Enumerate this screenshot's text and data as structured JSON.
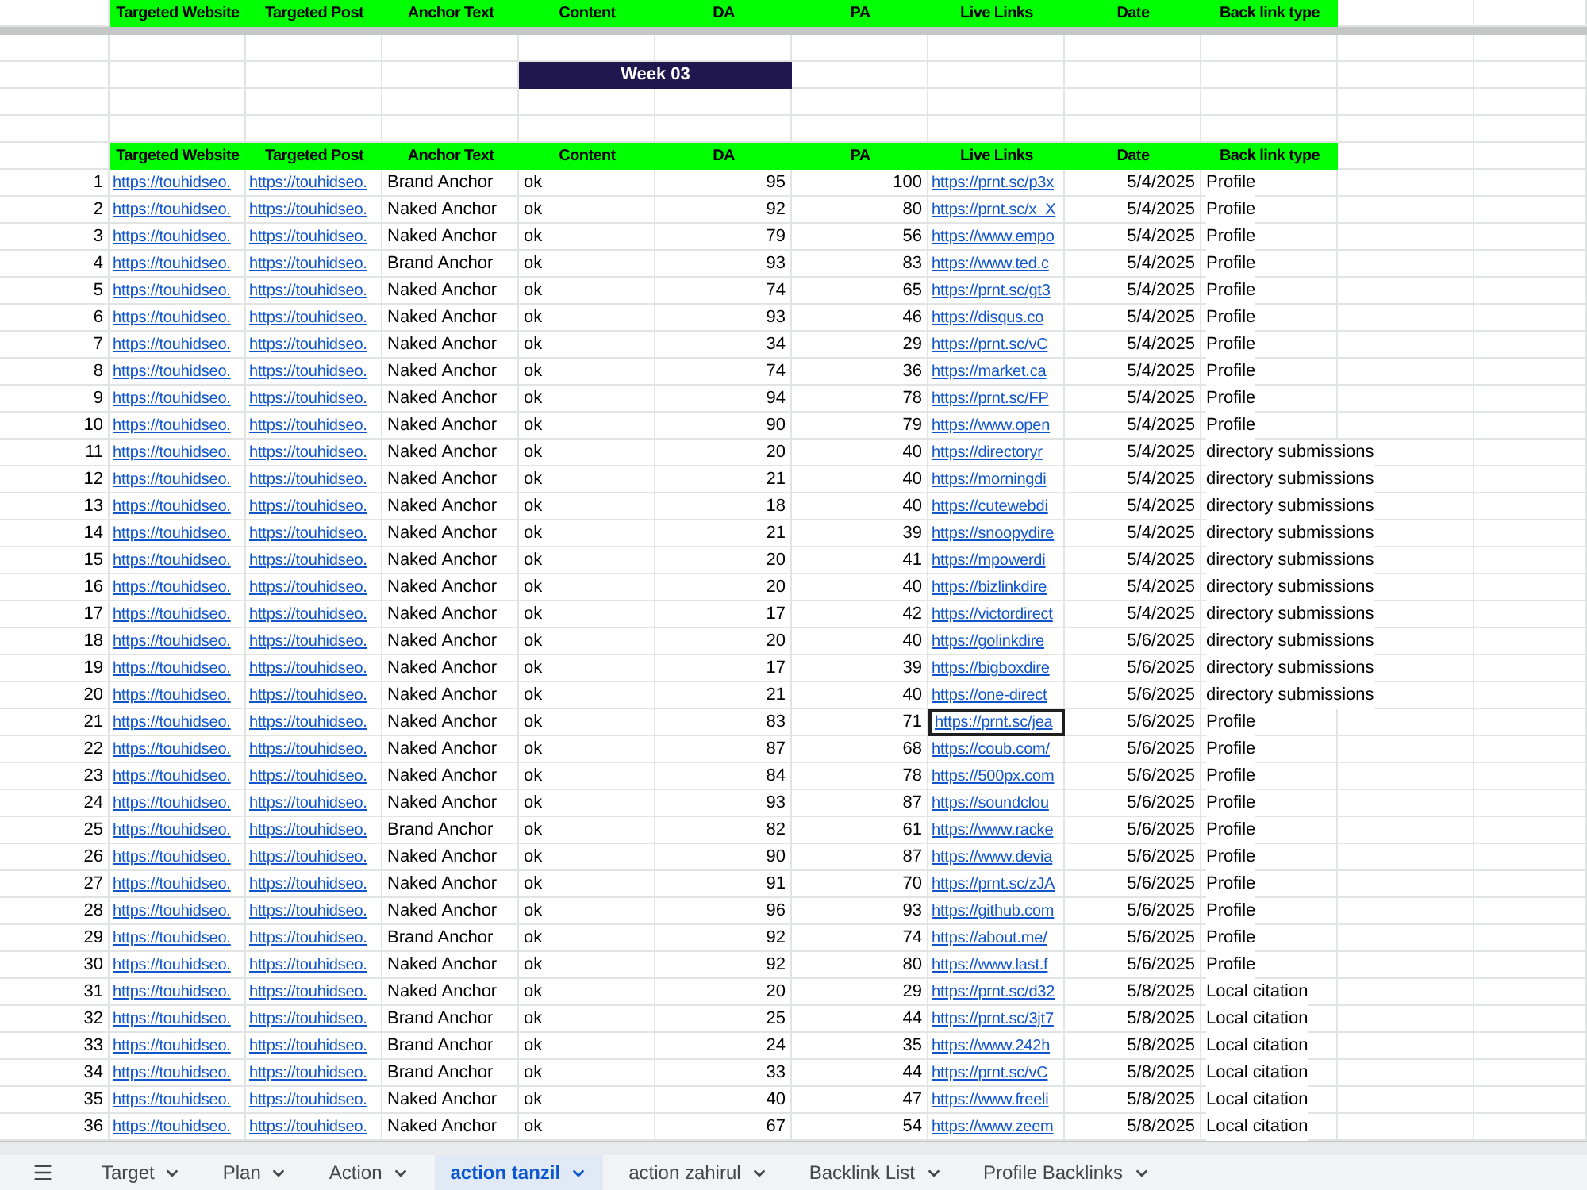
{
  "frozen_header": [
    "Targeted Website",
    "Targeted Post",
    "Anchor Text",
    "Content",
    "DA",
    "PA",
    "Live Links",
    "Date",
    "Back link type"
  ],
  "week_label": "Week 03",
  "table": {
    "columns": [
      "Targeted Website",
      "Targeted Post",
      "Anchor Text",
      "Content",
      "DA",
      "PA",
      "Live Links",
      "Date",
      "Back link type"
    ],
    "rows": [
      {
        "n": "1",
        "website": "https://touhidseo.",
        "post": "https://touhidseo.",
        "anchor": "Brand Anchor",
        "content": "ok",
        "da": "95",
        "pa": "100",
        "link": "https://prnt.sc/p3x",
        "date": "5/4/2025",
        "type": "Profile",
        "selected": false
      },
      {
        "n": "2",
        "website": "https://touhidseo.",
        "post": "https://touhidseo.",
        "anchor": "Naked Anchor",
        "content": "ok",
        "da": "92",
        "pa": "80",
        "link": "https://prnt.sc/x_X",
        "date": "5/4/2025",
        "type": "Profile",
        "selected": false
      },
      {
        "n": "3",
        "website": "https://touhidseo.",
        "post": "https://touhidseo.",
        "anchor": "Naked Anchor",
        "content": "ok",
        "da": "79",
        "pa": "56",
        "link": "https://www.empo",
        "date": "5/4/2025",
        "type": "Profile",
        "selected": false
      },
      {
        "n": "4",
        "website": "https://touhidseo.",
        "post": "https://touhidseo.",
        "anchor": "Brand Anchor",
        "content": "ok",
        "da": "93",
        "pa": "83",
        "link": "https://www.ted.c",
        "date": "5/4/2025",
        "type": "Profile",
        "selected": false
      },
      {
        "n": "5",
        "website": "https://touhidseo.",
        "post": "https://touhidseo.",
        "anchor": "Naked Anchor",
        "content": "ok",
        "da": "74",
        "pa": "65",
        "link": "https://prnt.sc/gt3",
        "date": "5/4/2025",
        "type": "Profile",
        "selected": false
      },
      {
        "n": "6",
        "website": "https://touhidseo.",
        "post": "https://touhidseo.",
        "anchor": "Naked Anchor",
        "content": "ok",
        "da": "93",
        "pa": "46",
        "link": "https://disqus.co",
        "date": "5/4/2025",
        "type": "Profile",
        "selected": false
      },
      {
        "n": "7",
        "website": "https://touhidseo.",
        "post": "https://touhidseo.",
        "anchor": "Naked Anchor",
        "content": "ok",
        "da": "34",
        "pa": "29",
        "link": "https://prnt.sc/vC",
        "date": "5/4/2025",
        "type": "Profile",
        "selected": false
      },
      {
        "n": "8",
        "website": "https://touhidseo.",
        "post": "https://touhidseo.",
        "anchor": "Naked Anchor",
        "content": "ok",
        "da": "74",
        "pa": "36",
        "link": "https://market.ca",
        "date": "5/4/2025",
        "type": "Profile",
        "selected": false
      },
      {
        "n": "9",
        "website": "https://touhidseo.",
        "post": "https://touhidseo.",
        "anchor": "Naked Anchor",
        "content": "ok",
        "da": "94",
        "pa": "78",
        "link": "https://prnt.sc/FP",
        "date": "5/4/2025",
        "type": "Profile",
        "selected": false
      },
      {
        "n": "10",
        "website": "https://touhidseo.",
        "post": "https://touhidseo.",
        "anchor": "Naked Anchor",
        "content": "ok",
        "da": "90",
        "pa": "79",
        "link": "https://www.open",
        "date": "5/4/2025",
        "type": "Profile",
        "selected": false
      },
      {
        "n": "11",
        "website": "https://touhidseo.",
        "post": "https://touhidseo.",
        "anchor": "Naked Anchor",
        "content": "ok",
        "da": "20",
        "pa": "40",
        "link": "https://directoryr",
        "date": "5/4/2025",
        "type": "directory submissions",
        "selected": false
      },
      {
        "n": "12",
        "website": "https://touhidseo.",
        "post": "https://touhidseo.",
        "anchor": "Naked Anchor",
        "content": "ok",
        "da": "21",
        "pa": "40",
        "link": "https://morningdi",
        "date": "5/4/2025",
        "type": "directory submissions",
        "selected": false
      },
      {
        "n": "13",
        "website": "https://touhidseo.",
        "post": "https://touhidseo.",
        "anchor": "Naked Anchor",
        "content": "ok",
        "da": "18",
        "pa": "40",
        "link": "https://cutewebdi",
        "date": "5/4/2025",
        "type": "directory submissions",
        "selected": false
      },
      {
        "n": "14",
        "website": "https://touhidseo.",
        "post": "https://touhidseo.",
        "anchor": "Naked Anchor",
        "content": "ok",
        "da": "21",
        "pa": "39",
        "link": "https://snoopydire",
        "date": "5/4/2025",
        "type": "directory submissions",
        "selected": false
      },
      {
        "n": "15",
        "website": "https://touhidseo.",
        "post": "https://touhidseo.",
        "anchor": "Naked Anchor",
        "content": "ok",
        "da": "20",
        "pa": "41",
        "link": "https://mpowerdi",
        "date": "5/4/2025",
        "type": "directory submissions",
        "selected": false
      },
      {
        "n": "16",
        "website": "https://touhidseo.",
        "post": "https://touhidseo.",
        "anchor": "Naked Anchor",
        "content": "ok",
        "da": "20",
        "pa": "40",
        "link": "https://bizlinkdire",
        "date": "5/4/2025",
        "type": "directory submissions",
        "selected": false
      },
      {
        "n": "17",
        "website": "https://touhidseo.",
        "post": "https://touhidseo.",
        "anchor": "Naked Anchor",
        "content": "ok",
        "da": "17",
        "pa": "42",
        "link": "https://victordirect",
        "date": "5/4/2025",
        "type": "directory submissions",
        "selected": false
      },
      {
        "n": "18",
        "website": "https://touhidseo.",
        "post": "https://touhidseo.",
        "anchor": "Naked Anchor",
        "content": "ok",
        "da": "20",
        "pa": "40",
        "link": "https://golinkdire",
        "date": "5/6/2025",
        "type": "directory submissions",
        "selected": false
      },
      {
        "n": "19",
        "website": "https://touhidseo.",
        "post": "https://touhidseo.",
        "anchor": "Naked Anchor",
        "content": "ok",
        "da": "17",
        "pa": "39",
        "link": "https://bigboxdire",
        "date": "5/6/2025",
        "type": "directory submissions",
        "selected": false
      },
      {
        "n": "20",
        "website": "https://touhidseo.",
        "post": "https://touhidseo.",
        "anchor": "Naked Anchor",
        "content": "ok",
        "da": "21",
        "pa": "40",
        "link": "https://one-direct",
        "date": "5/6/2025",
        "type": "directory submissions",
        "selected": false
      },
      {
        "n": "21",
        "website": "https://touhidseo.",
        "post": "https://touhidseo.",
        "anchor": "Naked Anchor",
        "content": "ok",
        "da": "83",
        "pa": "71",
        "link": "https://prnt.sc/jea",
        "date": "5/6/2025",
        "type": "Profile",
        "selected": true
      },
      {
        "n": "22",
        "website": "https://touhidseo.",
        "post": "https://touhidseo.",
        "anchor": "Naked Anchor",
        "content": "ok",
        "da": "87",
        "pa": "68",
        "link": "https://coub.com/",
        "date": "5/6/2025",
        "type": "Profile",
        "selected": false
      },
      {
        "n": "23",
        "website": "https://touhidseo.",
        "post": "https://touhidseo.",
        "anchor": "Naked Anchor",
        "content": "ok",
        "da": "84",
        "pa": "78",
        "link": "https://500px.com",
        "date": "5/6/2025",
        "type": "Profile",
        "selected": false
      },
      {
        "n": "24",
        "website": "https://touhidseo.",
        "post": "https://touhidseo.",
        "anchor": "Naked Anchor",
        "content": "ok",
        "da": "93",
        "pa": "87",
        "link": "https://soundclou",
        "date": "5/6/2025",
        "type": "Profile",
        "selected": false
      },
      {
        "n": "25",
        "website": "https://touhidseo.",
        "post": "https://touhidseo.",
        "anchor": "Brand Anchor",
        "content": "ok",
        "da": "82",
        "pa": "61",
        "link": "https://www.racke",
        "date": "5/6/2025",
        "type": "Profile",
        "selected": false
      },
      {
        "n": "26",
        "website": "https://touhidseo.",
        "post": "https://touhidseo.",
        "anchor": "Naked Anchor",
        "content": "ok",
        "da": "90",
        "pa": "87",
        "link": "https://www.devia",
        "date": "5/6/2025",
        "type": "Profile",
        "selected": false
      },
      {
        "n": "27",
        "website": "https://touhidseo.",
        "post": "https://touhidseo.",
        "anchor": "Naked Anchor",
        "content": "ok",
        "da": "91",
        "pa": "70",
        "link": "https://prnt.sc/zJA",
        "date": "5/6/2025",
        "type": "Profile",
        "selected": false
      },
      {
        "n": "28",
        "website": "https://touhidseo.",
        "post": "https://touhidseo.",
        "anchor": "Naked Anchor",
        "content": "ok",
        "da": "96",
        "pa": "93",
        "link": "https://github.com",
        "date": "5/6/2025",
        "type": "Profile",
        "selected": false
      },
      {
        "n": "29",
        "website": "https://touhidseo.",
        "post": "https://touhidseo.",
        "anchor": "Brand Anchor",
        "content": "ok",
        "da": "92",
        "pa": "74",
        "link": "https://about.me/",
        "date": "5/6/2025",
        "type": "Profile",
        "selected": false
      },
      {
        "n": "30",
        "website": "https://touhidseo.",
        "post": "https://touhidseo.",
        "anchor": "Naked Anchor",
        "content": "ok",
        "da": "92",
        "pa": "80",
        "link": "https://www.last.f",
        "date": "5/6/2025",
        "type": "Profile",
        "selected": false
      },
      {
        "n": "31",
        "website": "https://touhidseo.",
        "post": "https://touhidseo.",
        "anchor": "Naked Anchor",
        "content": "ok",
        "da": "20",
        "pa": "29",
        "link": "https://prnt.sc/d32",
        "date": "5/8/2025",
        "type": "Local citation",
        "selected": false
      },
      {
        "n": "32",
        "website": "https://touhidseo.",
        "post": "https://touhidseo.",
        "anchor": "Brand Anchor",
        "content": "ok",
        "da": "25",
        "pa": "44",
        "link": "https://prnt.sc/3jt7",
        "date": "5/8/2025",
        "type": "Local citation",
        "selected": false
      },
      {
        "n": "33",
        "website": "https://touhidseo.",
        "post": "https://touhidseo.",
        "anchor": "Brand Anchor",
        "content": "ok",
        "da": "24",
        "pa": "35",
        "link": "https://www.242h",
        "date": "5/8/2025",
        "type": "Local citation",
        "selected": false
      },
      {
        "n": "34",
        "website": "https://touhidseo.",
        "post": "https://touhidseo.",
        "anchor": "Brand Anchor",
        "content": "ok",
        "da": "33",
        "pa": "44",
        "link": "https://prnt.sc/vC",
        "date": "5/8/2025",
        "type": "Local citation",
        "selected": false
      },
      {
        "n": "35",
        "website": "https://touhidseo.",
        "post": "https://touhidseo.",
        "anchor": "Naked Anchor",
        "content": "ok",
        "da": "40",
        "pa": "47",
        "link": "https://www.freeli",
        "date": "5/8/2025",
        "type": "Local citation",
        "selected": false
      },
      {
        "n": "36",
        "website": "https://touhidseo.",
        "post": "https://touhidseo.",
        "anchor": "Naked Anchor",
        "content": "ok",
        "da": "67",
        "pa": "54",
        "link": "https://www.zeem",
        "date": "5/8/2025",
        "type": "Local citation",
        "selected": false
      }
    ]
  },
  "sheet_tabs": [
    {
      "label": "Target",
      "selected": false
    },
    {
      "label": "Plan",
      "selected": false
    },
    {
      "label": "Action",
      "selected": false
    },
    {
      "label": "action tanzil",
      "selected": true
    },
    {
      "label": "action zahirul",
      "selected": false
    },
    {
      "label": "Backlink List",
      "selected": false
    },
    {
      "label": "Profile Backlinks",
      "selected": false
    }
  ]
}
